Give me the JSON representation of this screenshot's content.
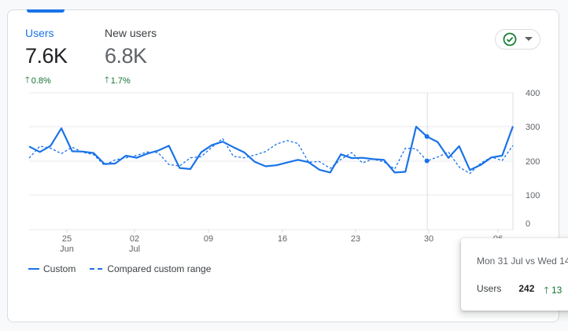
{
  "metrics": [
    {
      "label": "Users",
      "value": "7.6K",
      "delta": "0.8%"
    },
    {
      "label": "New users",
      "value": "6.8K",
      "delta": "1.7%"
    }
  ],
  "status_icon": "check-circle-icon",
  "chart_data": {
    "type": "line",
    "y_ticks": [
      "400",
      "300",
      "200",
      "100",
      "0"
    ],
    "ylim": [
      0,
      400
    ],
    "x_ticks": [
      {
        "day": "25",
        "month": "Jun"
      },
      {
        "day": "02",
        "month": "Jul"
      },
      {
        "day": "09",
        "month": ""
      },
      {
        "day": "16",
        "month": ""
      },
      {
        "day": "23",
        "month": ""
      },
      {
        "day": "30",
        "month": ""
      },
      {
        "day": "06",
        "month": "Aug"
      }
    ],
    "series": [
      {
        "name": "Custom",
        "style": "solid",
        "color": "#1a73e8",
        "values": [
          243,
          227,
          245,
          296,
          229,
          228,
          224,
          192,
          193,
          216,
          210,
          222,
          231,
          245,
          180,
          177,
          226,
          247,
          257,
          241,
          226,
          198,
          185,
          188,
          196,
          204,
          197,
          175,
          167,
          220,
          209,
          210,
          206,
          204,
          167,
          169,
          301,
          272,
          256,
          210,
          244,
          174,
          189,
          211,
          216,
          302
        ]
      },
      {
        "name": "Compared custom range",
        "style": "dashed",
        "color": "#1a73e8",
        "values": [
          209,
          244,
          238,
          222,
          241,
          226,
          219,
          188,
          204,
          210,
          217,
          227,
          225,
          190,
          186,
          210,
          213,
          241,
          266,
          214,
          210,
          218,
          228,
          250,
          260,
          252,
          197,
          199,
          179,
          205,
          225,
          195,
          206,
          198,
          177,
          238,
          236,
          201,
          212,
          227,
          183,
          164,
          194,
          212,
          202,
          246
        ]
      }
    ]
  },
  "legend": [
    {
      "label": "Custom"
    },
    {
      "label": "Compared custom range"
    }
  ],
  "tooltip": {
    "title": "Mon 31 Jul vs Wed 14",
    "metric": "Users",
    "value": "242",
    "delta": "13"
  }
}
